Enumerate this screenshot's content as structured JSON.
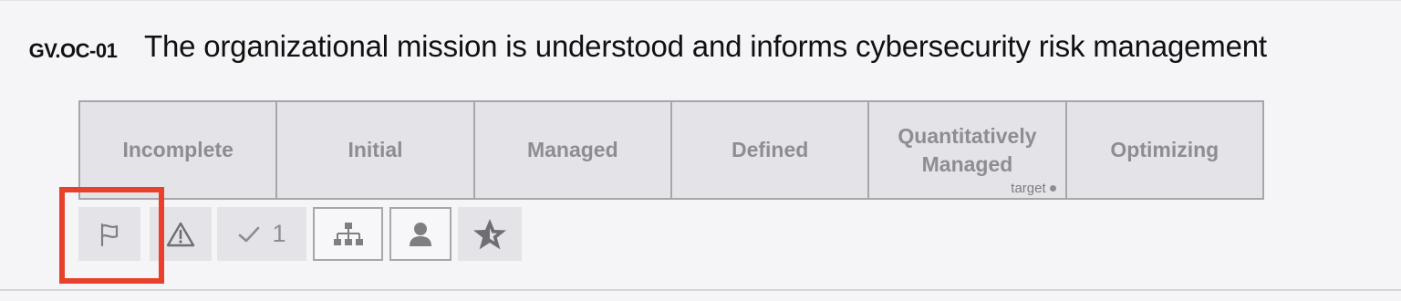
{
  "control": {
    "id": "GV.OC-01",
    "title": "The organizational mission is understood and informs cybersecurity risk management"
  },
  "maturity_levels": [
    {
      "label": "Incomplete"
    },
    {
      "label": "Initial"
    },
    {
      "label": "Managed"
    },
    {
      "label": "Defined"
    },
    {
      "label": "Quantitatively Managed",
      "marker": "target"
    },
    {
      "label": "Optimizing"
    }
  ],
  "toolbar": {
    "buttons": [
      {
        "icon": "flag-icon",
        "highlighted": true
      },
      {
        "icon": "warning-icon"
      },
      {
        "icon": "check-icon",
        "count": "1"
      },
      {
        "icon": "org-chart-icon"
      },
      {
        "icon": "person-icon"
      },
      {
        "icon": "star-icon"
      }
    ]
  },
  "colors": {
    "cell_background": "#e4e4e8",
    "border": "#a6a6ab",
    "muted_text": "#8d8d92",
    "highlight": "#e8402a",
    "page_background": "#f5f5f7"
  }
}
